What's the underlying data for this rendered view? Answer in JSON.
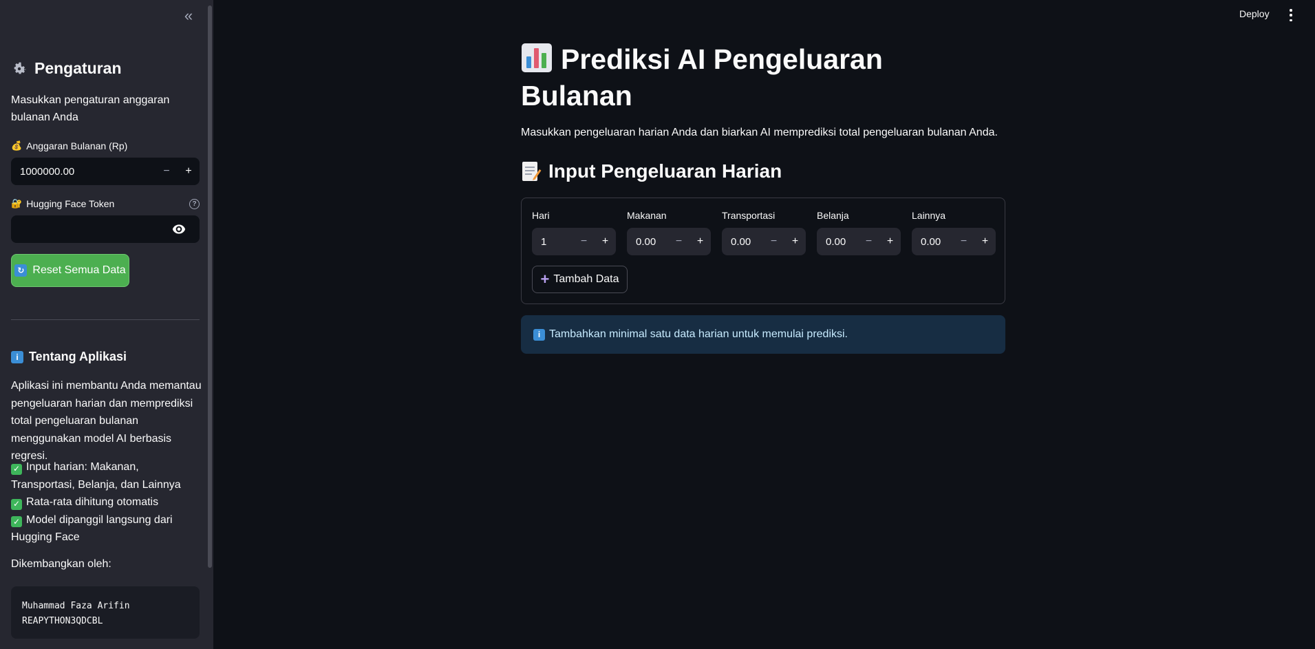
{
  "header": {
    "deploy_label": "Deploy"
  },
  "sidebar": {
    "title": "Pengaturan",
    "description": "Masukkan pengaturan anggaran bulanan Anda",
    "budget": {
      "label": "Anggaran Bulanan (Rp)",
      "value": "1000000.00",
      "minus": "−",
      "plus": "+"
    },
    "token": {
      "label": "Hugging Face Token",
      "value": ""
    },
    "reset_button": "Reset Semua Data",
    "about": {
      "title": "Tentang Aplikasi",
      "text": "Aplikasi ini membantu Anda memantau pengeluaran harian dan memprediksi total pengeluaran bulanan menggunakan model AI berbasis regresi.",
      "features": [
        "Input harian: Makanan, Transportasi, Belanja, dan Lainnya",
        "Rata-rata dihitung otomatis",
        "Model dipanggil langsung dari Hugging Face"
      ],
      "developer_label": "Dikembangkan oleh:",
      "developer_lines": [
        "Muhammad Faza Arifin",
        "REAPYTHON3QDCBL"
      ]
    }
  },
  "main": {
    "title": "Prediksi AI Pengeluaran Bulanan",
    "description": "Masukkan pengeluaran harian Anda dan biarkan AI memprediksi total pengeluaran bulanan Anda.",
    "section_title": "Input Pengeluaran Harian",
    "fields": [
      {
        "label": "Hari",
        "value": "1"
      },
      {
        "label": "Makanan",
        "value": "0.00"
      },
      {
        "label": "Transportasi",
        "value": "0.00"
      },
      {
        "label": "Belanja",
        "value": "0.00"
      },
      {
        "label": "Lainnya",
        "value": "0.00"
      }
    ],
    "add_button": "Tambah Data",
    "info_message": "Tambahkan minimal satu data harian untuk memulai prediksi."
  },
  "colors": {
    "background": "#0e1117",
    "sidebar": "#262730",
    "primary_button": "#4caf50",
    "info_bg": "#172d43",
    "info_text": "#c7ebff"
  }
}
